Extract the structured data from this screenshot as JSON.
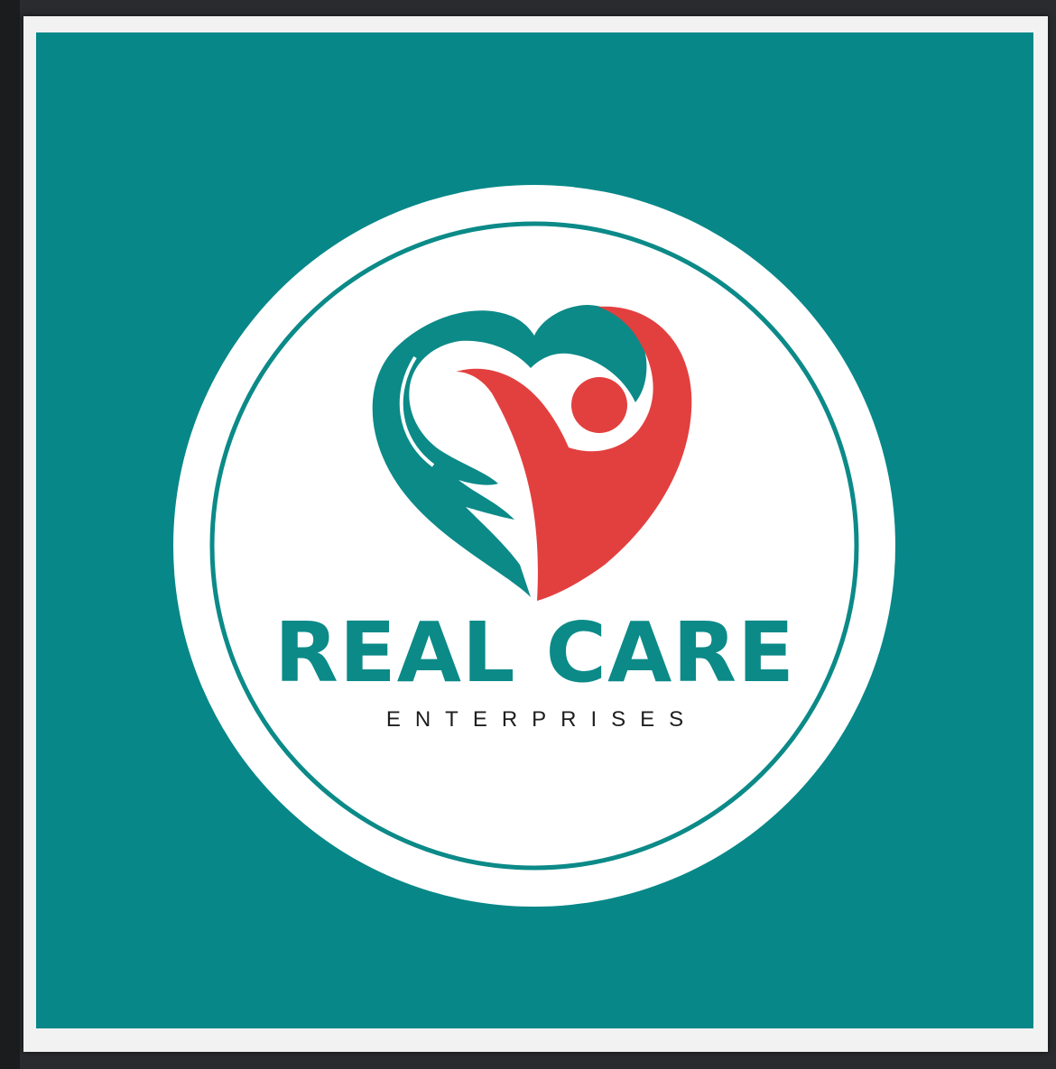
{
  "logo": {
    "title": "REAL CARE",
    "subtitle": "ENTERPRISES",
    "icon": "heart-with-hands-and-person-icon"
  },
  "colors": {
    "background": "#078788",
    "teal": "#0b8a88",
    "red": "#e2403f",
    "white": "#ffffff",
    "text_dark": "#1f1f1f",
    "viewer_chrome": "#2a2b2e"
  }
}
